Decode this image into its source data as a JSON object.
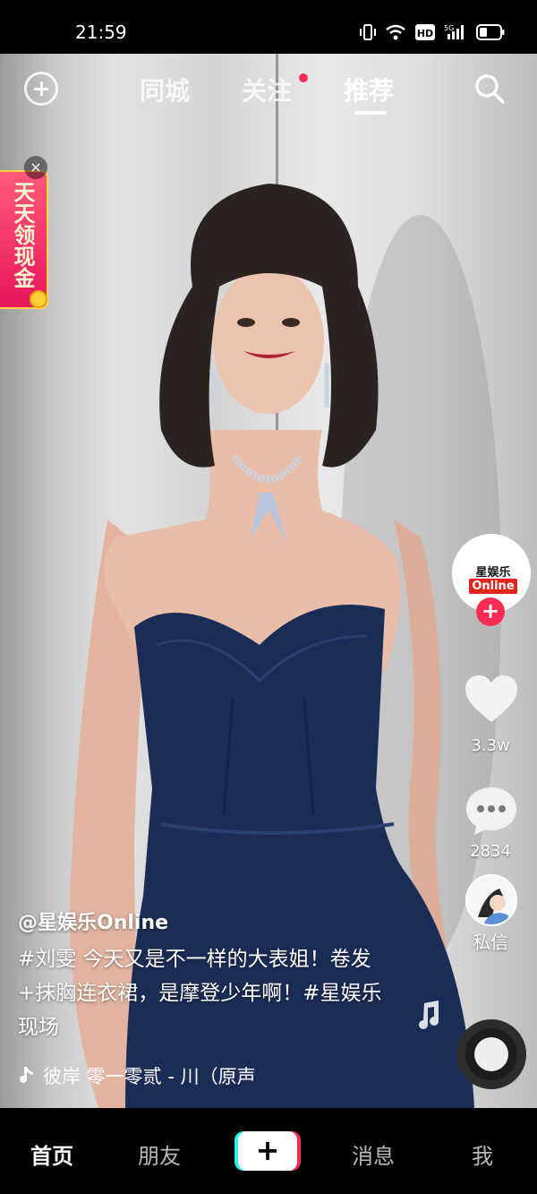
{
  "status_bar": {
    "time": "21:59"
  },
  "top_nav": {
    "tabs": [
      {
        "label": "同城"
      },
      {
        "label": "关注"
      },
      {
        "label": "推荐"
      }
    ],
    "active_tab": "推荐"
  },
  "promo": {
    "text": "天天领现金",
    "close": "×"
  },
  "creator": {
    "avatar_text": "星娱乐",
    "avatar_badge": "Online",
    "follow": "+"
  },
  "actions": {
    "likes": "3.3w",
    "comments": "2834",
    "dm": "私信"
  },
  "post": {
    "author": "@星娱乐Online",
    "caption": "#刘雯 今天又是不一样的大表姐！卷发+抹胸连衣裙，是摩登少年啊！#星娱乐现场",
    "music": "彼岸 零一零贰 - 川（原声"
  },
  "bottom_nav": {
    "home": "首页",
    "friends": "朋友",
    "create": "+",
    "messages": "消息",
    "me": "我"
  },
  "colors": {
    "accent": "#fe2c55",
    "cyan": "#25f4ee",
    "dress": "#1b2d57"
  }
}
